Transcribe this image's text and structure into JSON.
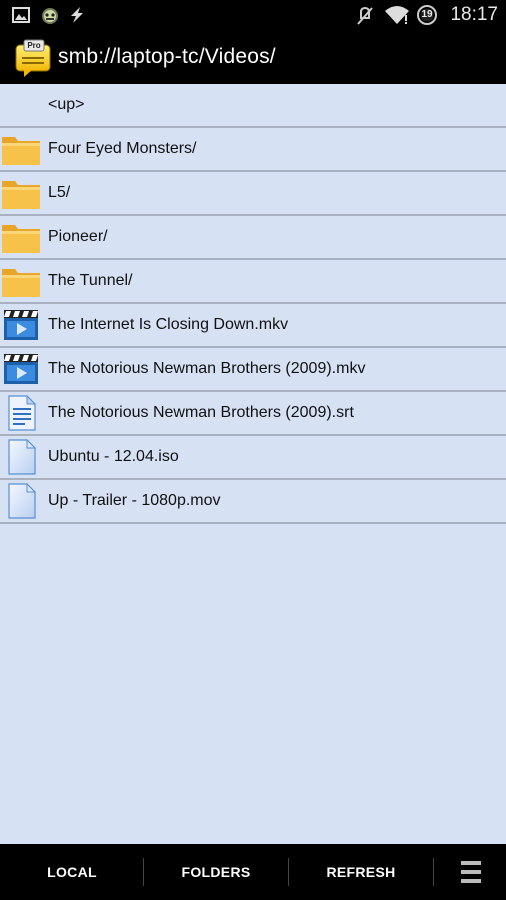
{
  "status_bar": {
    "time": "18:17",
    "badge_number": "19",
    "left_icons": [
      "image-icon",
      "android-icon",
      "flash-icon"
    ],
    "right_icons": [
      "signal-muted-icon",
      "wifi-icon",
      "notification-badge-icon"
    ]
  },
  "title_bar": {
    "logo_badge": "Pro",
    "title": "smb://laptop-tc/Videos/"
  },
  "files": [
    {
      "label": "<up>",
      "icon": "none"
    },
    {
      "label": "Four Eyed Monsters/",
      "icon": "folder"
    },
    {
      "label": "L5/",
      "icon": "folder"
    },
    {
      "label": "Pioneer/",
      "icon": "folder"
    },
    {
      "label": "The Tunnel/",
      "icon": "folder"
    },
    {
      "label": "The Internet Is Closing Down.mkv",
      "icon": "video"
    },
    {
      "label": "The Notorious Newman Brothers (2009).mkv",
      "icon": "video"
    },
    {
      "label": "The Notorious Newman Brothers (2009).srt",
      "icon": "text"
    },
    {
      "label": "Ubuntu - 12.04.iso",
      "icon": "file"
    },
    {
      "label": "Up - Trailer - 1080p.mov",
      "icon": "file"
    }
  ],
  "bottom_bar": {
    "local": "LOCAL",
    "folders": "FOLDERS",
    "refresh": "REFRESH"
  },
  "colors": {
    "list_background": "#d7e1f4",
    "row_divider": "#a9b1bf",
    "folder": "#f4b63a",
    "bar_background": "#000000"
  }
}
